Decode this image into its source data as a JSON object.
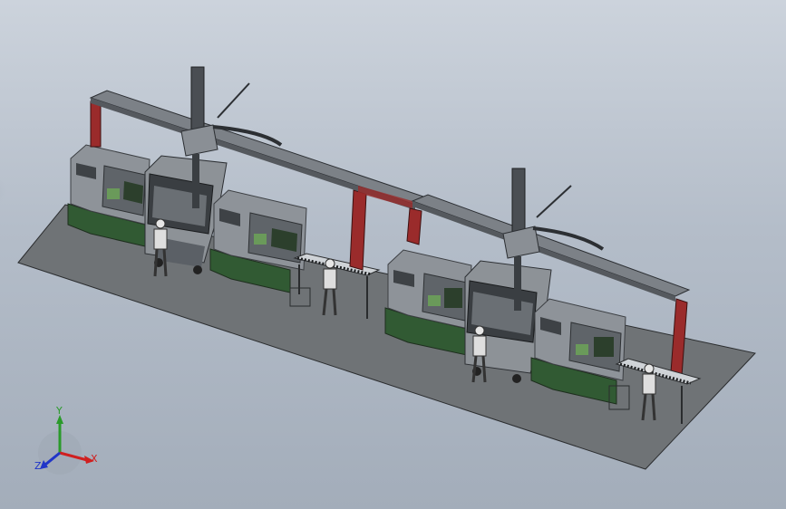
{
  "app": {
    "kind": "CAD 3D assembly viewport",
    "background_colors": [
      "#ccd3dc",
      "#a3adba"
    ]
  },
  "scene": {
    "cell_count": 2,
    "cell_components": [
      "gantry-robot",
      "cnc-lathe-left",
      "cnc-lathe-right",
      "robot-cage",
      "operator-figure",
      "roller-conveyor",
      "operator-figure-conveyor"
    ],
    "colors": {
      "floor": "#6f7376",
      "lathe_base": "#315a33",
      "lathe_body": "#8e9399",
      "gantry_post": "#9a2b2b",
      "gantry_beam": "#7c8187",
      "robot_arm": "#4a4e53"
    }
  },
  "triad": {
    "x_label": "X",
    "y_label": "Y",
    "z_label": "Z",
    "x_color": "#d01f1f",
    "y_color": "#2a9a2a",
    "z_color": "#2035c8"
  }
}
